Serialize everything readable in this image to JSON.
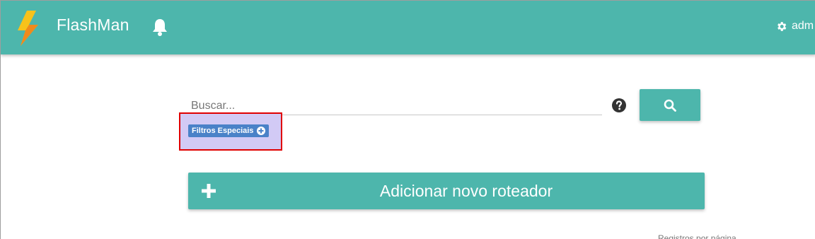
{
  "header": {
    "brand": "FlashMan",
    "user_label": "adm",
    "logo_icon": "lightning-bolt-icon",
    "bell_icon": "bell-icon",
    "gear_icon": "gear-icon"
  },
  "search": {
    "placeholder": "Buscar...",
    "value": "",
    "help_icon": "question-circle-icon",
    "button_icon": "search-icon"
  },
  "filters": {
    "label": "Filtros Especiais",
    "icon": "plus-circle-icon"
  },
  "add_router": {
    "label": "Adicionar novo roteador",
    "icon": "plus-icon"
  },
  "pagination": {
    "records_label": "Registros por página"
  },
  "colors": {
    "primary": "#4db6ac",
    "badge": "#4a82c8",
    "highlight_fill": "#d2caf5",
    "highlight_border": "#e00000"
  }
}
